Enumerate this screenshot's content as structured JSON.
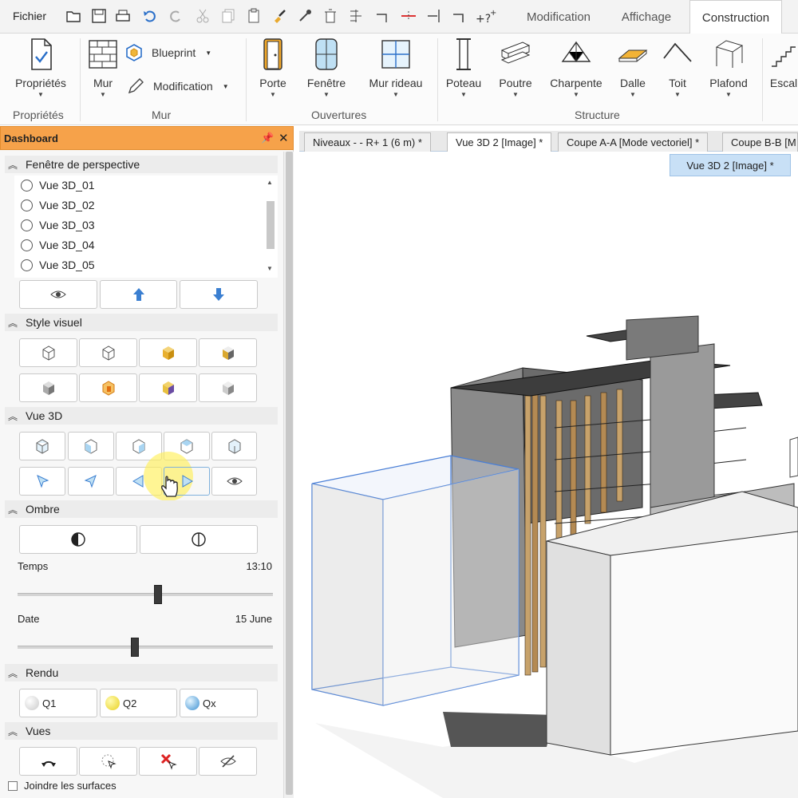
{
  "topbar": {
    "file_menu": "Fichier",
    "tabs": [
      {
        "label": "Modification"
      },
      {
        "label": "Affichage"
      },
      {
        "label": "Construction",
        "active": true
      }
    ]
  },
  "ribbon": {
    "proprietes": {
      "button": "Propriétés",
      "group": "Propriétés"
    },
    "mur": {
      "button": "Mur",
      "blueprint": "Blueprint",
      "modification": "Modification",
      "group": "Mur"
    },
    "ouvertures": {
      "porte": "Porte",
      "fenetre": "Fenêtre",
      "mur_rideau": "Mur rideau",
      "group": "Ouvertures"
    },
    "structure": {
      "poteau": "Poteau",
      "poutre": "Poutre",
      "charpente": "Charpente",
      "dalle": "Dalle",
      "toit": "Toit",
      "plafond": "Plafond",
      "escalier": "Escal",
      "group": "Structure"
    }
  },
  "dashboard": {
    "title": "Dashboard",
    "perspective": {
      "title": "Fenêtre de perspective",
      "items": [
        "Vue 3D_01",
        "Vue 3D_02",
        "Vue 3D_03",
        "Vue 3D_04",
        "Vue 3D_05"
      ]
    },
    "style_visuel": {
      "title": "Style visuel"
    },
    "vue3d": {
      "title": "Vue 3D"
    },
    "ombre": {
      "title": "Ombre",
      "temps_label": "Temps",
      "temps_value": "13:10",
      "temps_fraction": 0.55,
      "date_label": "Date",
      "date_value": "15 June",
      "date_fraction": 0.46
    },
    "rendu": {
      "title": "Rendu",
      "buttons": [
        "Q1",
        "Q2",
        "Qx"
      ]
    },
    "vues": {
      "title": "Vues"
    },
    "join_surfaces": "Joindre les surfaces"
  },
  "doc_tabs": [
    {
      "label": "Niveaux -  - R+ 1 (6 m) *"
    },
    {
      "label": "Vue 3D 2 [Image] *",
      "active": true
    },
    {
      "label": "Coupe A-A [Mode vectoriel] *"
    },
    {
      "label": "Coupe B-B [M"
    }
  ],
  "tab_tooltip": "Vue 3D 2 [Image] *",
  "colors": {
    "dashboard_header": "#f6a24a",
    "accent_blue": "#3b7fd1",
    "selection_box": "#4a7fd6"
  }
}
